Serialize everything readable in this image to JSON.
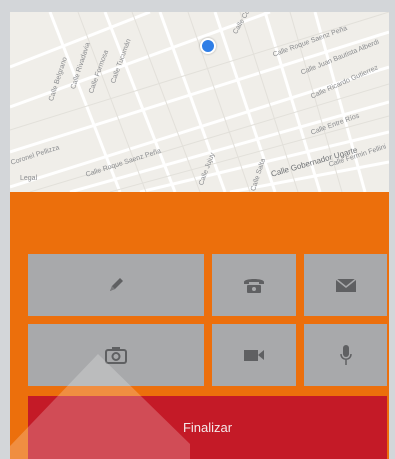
{
  "map": {
    "legal_label": "Legal",
    "street_labels": [
      "Calle Coronel Dorrego",
      "Calle Roque Saenz Peña",
      "Calle Juan Bautista Alberdi",
      "Calle Ricardo Gutierrez",
      "Calle Entre Ríos",
      "Calle Gobernador Ugarte",
      "Calle Fermin Fellini",
      "Calle Roque Saenz Peña",
      "Calle Tucumán",
      "Calle Formosa",
      "Calle Rivadavia",
      "Calle Belgrano",
      "Calle Jujuy",
      "Calle Salta",
      "Coronel Pellizza"
    ]
  },
  "actions": {
    "edit": {
      "icon": "pencil-icon"
    },
    "phone": {
      "icon": "phone-icon"
    },
    "email": {
      "icon": "envelope-icon"
    },
    "photo": {
      "icon": "camera-icon"
    },
    "video": {
      "icon": "video-camera-icon"
    },
    "audio": {
      "icon": "microphone-icon"
    }
  },
  "finalize_label": "Finalizar",
  "colors": {
    "orange": "#ec6f0c",
    "tile_gray": "#a8a9ab",
    "finalize_red": "#c41a27",
    "location_blue": "#2f7ee6"
  }
}
